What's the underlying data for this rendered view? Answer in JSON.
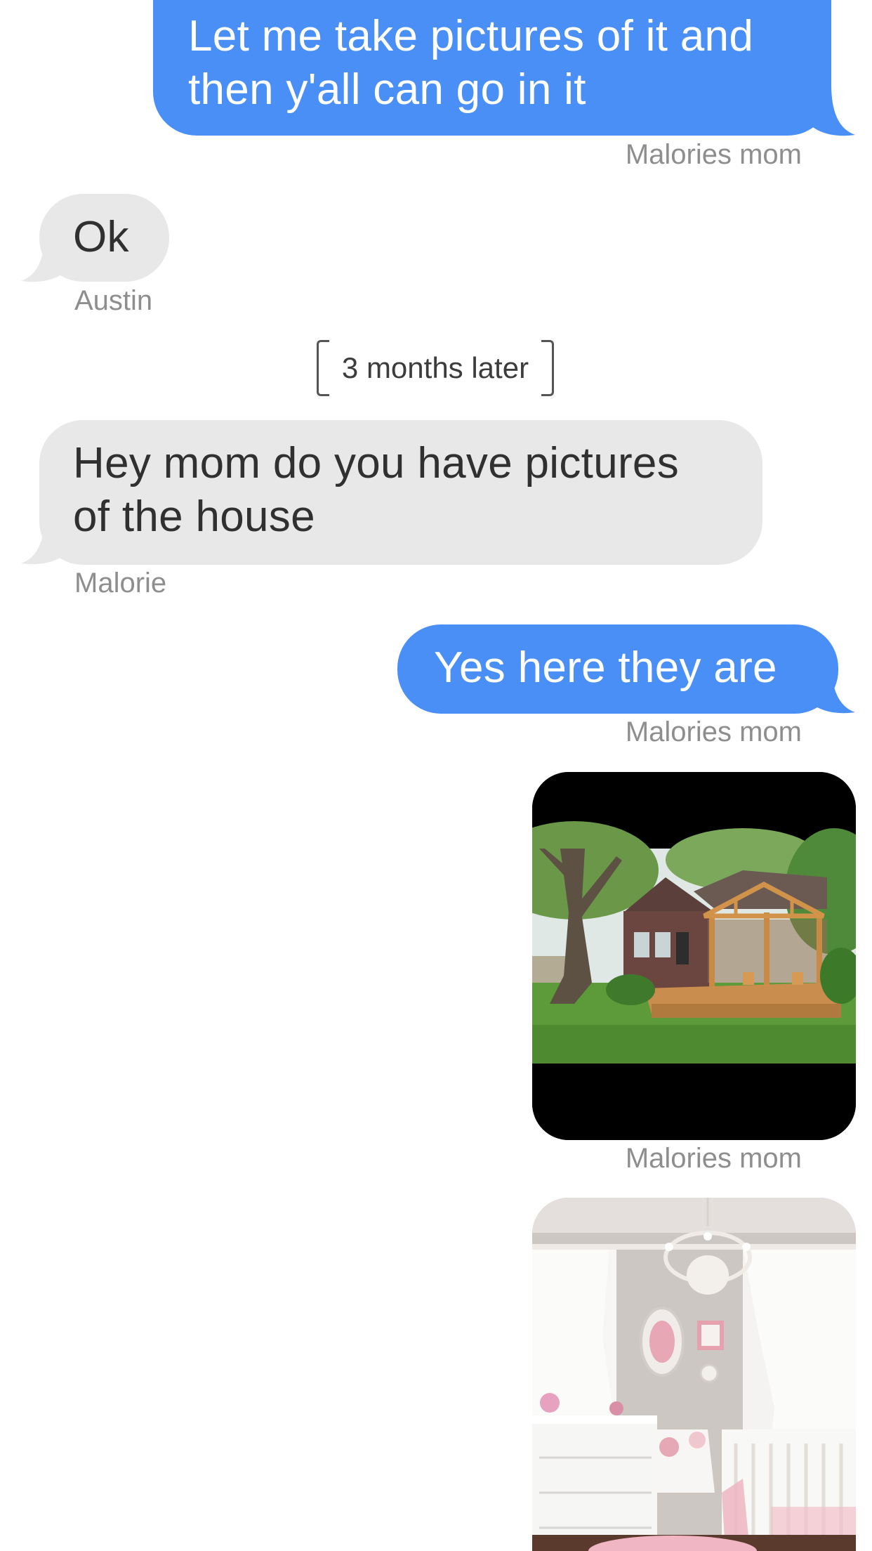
{
  "messages": [
    {
      "text_line1": "Let me take pictures of it and",
      "text_line2": "then y'all can go in it",
      "sender": "Malories mom"
    },
    {
      "text": "Ok",
      "sender": "Austin"
    },
    {
      "text_line1": "Hey mom do you have pictures",
      "text_line2": "of the house",
      "sender": "Malorie"
    },
    {
      "text": "Yes here they are",
      "sender": "Malories mom"
    },
    {
      "image": "house-with-deck-photo",
      "sender": "Malories mom"
    },
    {
      "image": "nursery-room-photo"
    }
  ],
  "divider": {
    "text": "3 months later"
  },
  "colors": {
    "sent_bubble": "#4a8ff6",
    "received_bubble": "#e8e8e8",
    "name_text": "#8e8e8e"
  }
}
